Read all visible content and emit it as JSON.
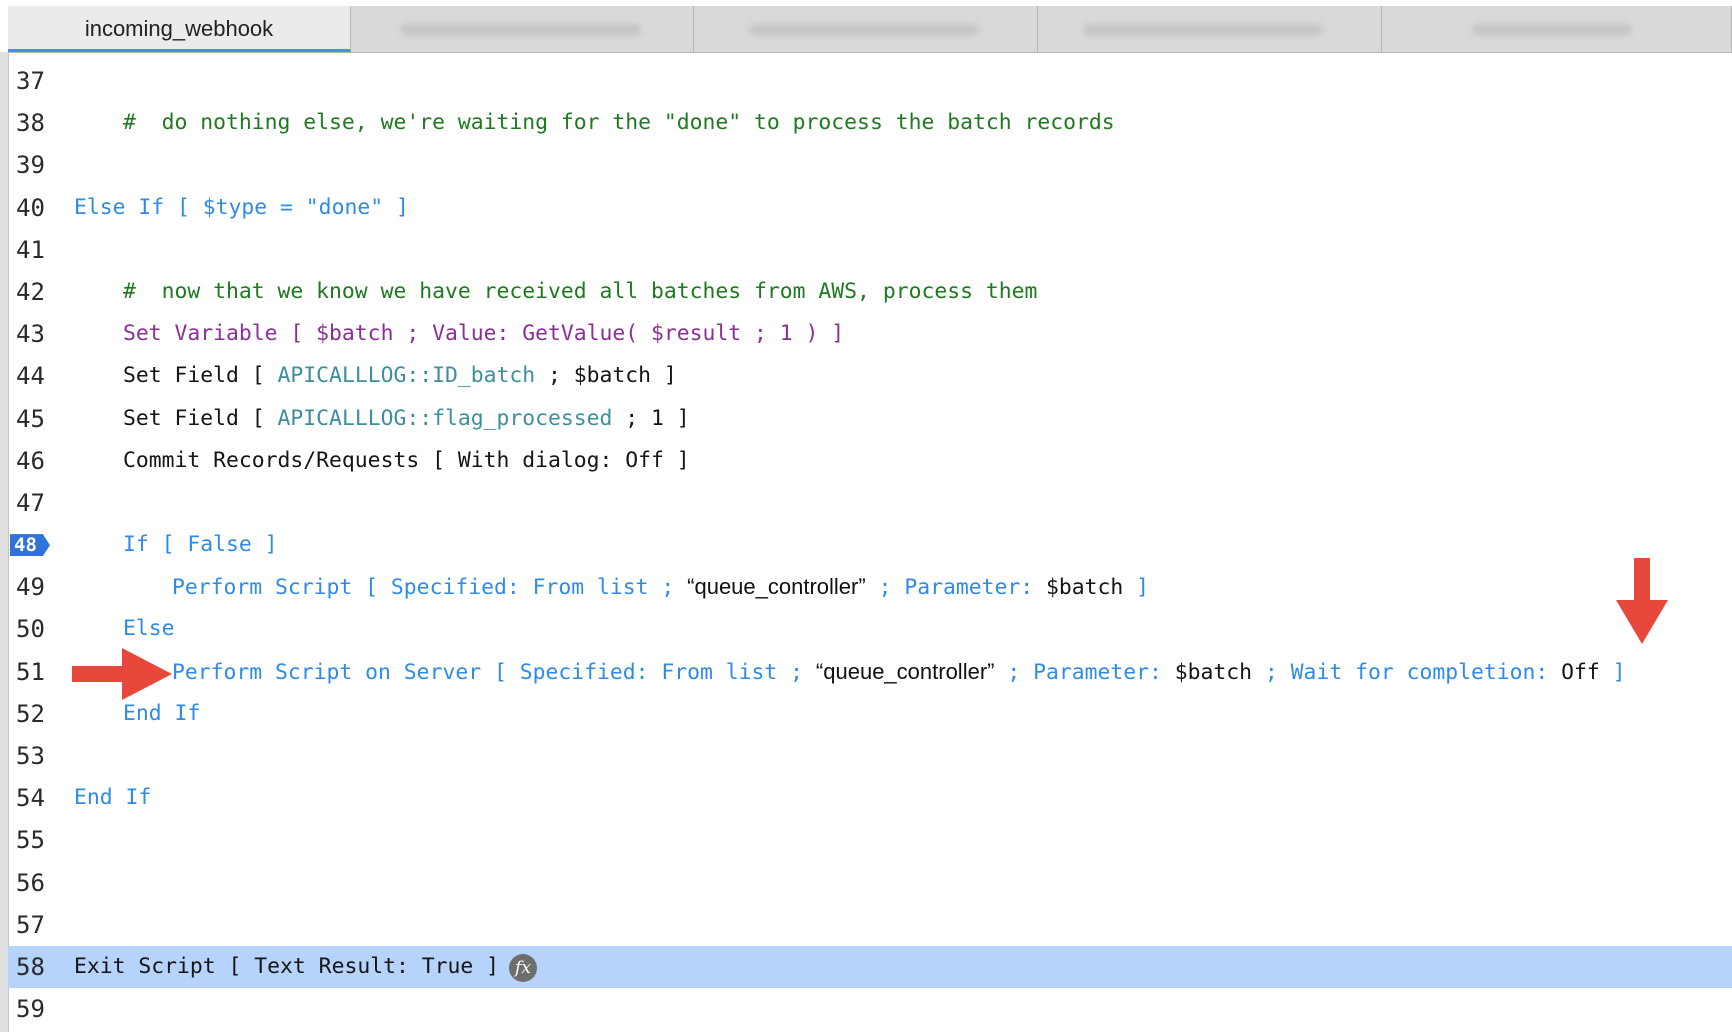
{
  "tabs": [
    {
      "label": "incoming_webhook",
      "active": true
    },
    {
      "label": "",
      "active": false
    },
    {
      "label": "",
      "active": false
    },
    {
      "label": "",
      "active": false
    },
    {
      "label": "",
      "active": false
    }
  ],
  "lines": {
    "n37": "37",
    "n38": "38",
    "n39": "39",
    "n40": "40",
    "n41": "41",
    "n42": "42",
    "n43": "43",
    "n44": "44",
    "n45": "45",
    "n46": "46",
    "n47": "47",
    "n48": "48",
    "n49": "49",
    "n50": "50",
    "n51": "51",
    "n52": "52",
    "n53": "53",
    "n54": "54",
    "n55": "55",
    "n56": "56",
    "n57": "57",
    "n58": "58",
    "n59": "59"
  },
  "code": {
    "l38": "#  do nothing else, we're waiting for the \"done\" to process the batch records",
    "l40": "Else If [ $type = \"done\" ]",
    "l42": "#  now that we know we have received all batches from AWS, process them",
    "l43": "Set Variable [ $batch ; Value: GetValue( $result ; 1 ) ]",
    "l44_step": "Set Field [ ",
    "l44_field": "APICALLLOG::ID_batch",
    "l44_rest": " ; $batch ]",
    "l45_step": "Set Field [ ",
    "l45_field": "APICALLLOG::flag_processed",
    "l45_rest": " ; 1 ]",
    "l46": "Commit Records/Requests [ With dialog: Off ]",
    "l48": "If [ False ]",
    "l49_a": "Perform Script [ Specified: From list ; ",
    "l49_b": "“queue_controller”",
    "l49_c": " ; Parameter: ",
    "l49_d": "$batch",
    "l49_e": " ]",
    "l50": "Else",
    "l51_a": "Perform Script on Server [ Specified: From list ; ",
    "l51_b": "“queue_controller”",
    "l51_c": " ; Parameter: ",
    "l51_d": "$batch",
    "l51_e": " ; Wait for completion: ",
    "l51_f": "Off",
    "l51_g": " ]",
    "l52": "End If",
    "l54": "End If",
    "l58": "Exit Script [ Text Result: True ]",
    "l58_icon": "fx"
  },
  "icons": {
    "function": "fx-icon",
    "annotation_arrow": "red-arrow"
  },
  "colors": {
    "keyword": "#2f8be6",
    "comment": "#1f7a1f",
    "variable_step": "#8b2f97",
    "field": "#3d8f9c",
    "selection": "#b5d3fb",
    "breakpoint": "#2f73d9",
    "arrow": "#e8483b"
  }
}
